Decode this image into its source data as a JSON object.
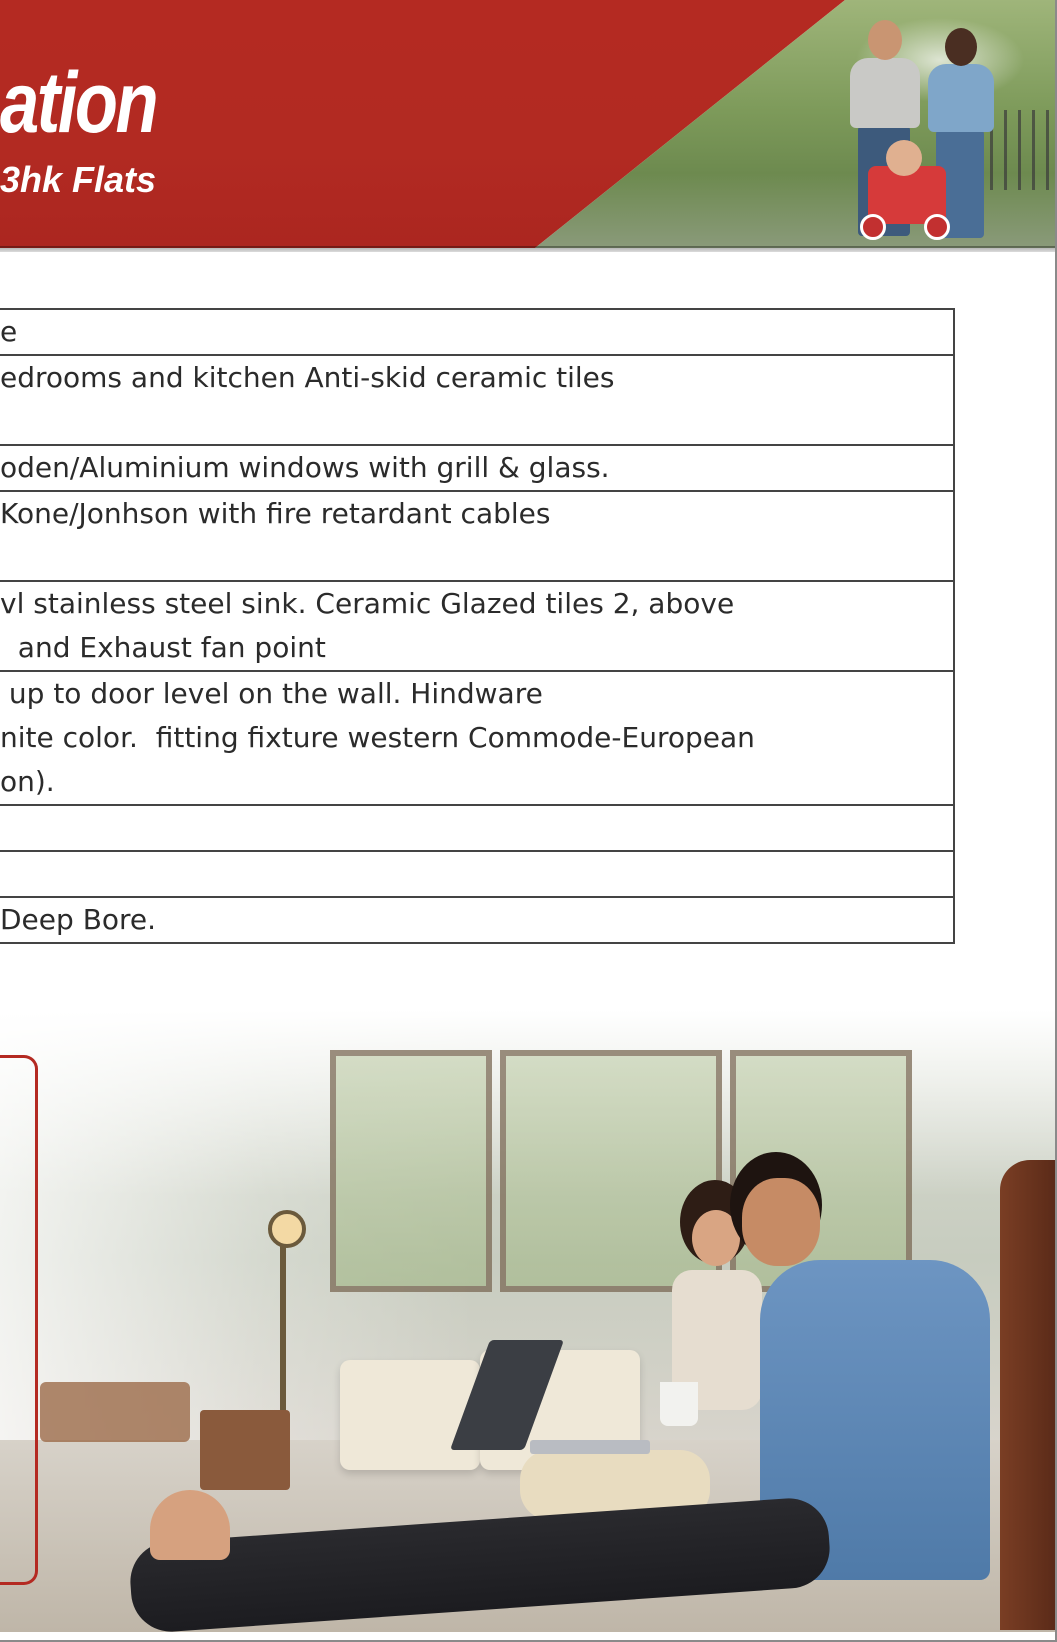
{
  "header": {
    "title": "ation",
    "subtitle": "3hk Flats",
    "brand_color": "#b42a22"
  },
  "spec_rows": [
    {
      "lines": [
        "e"
      ]
    },
    {
      "lines": [
        "edrooms and kitchen Anti-skid ceramic tiles",
        ""
      ]
    },
    {
      "lines": [
        "oden/Aluminium windows with grill & glass."
      ]
    },
    {
      "lines": [
        "Kone/Jonhson with fire retardant cables",
        ""
      ]
    },
    {
      "lines": [
        "vl stainless steel sink. Ceramic Glazed tiles 2, above",
        "  and Exhaust fan point"
      ]
    },
    {
      "lines": [
        " up to door level on the wall. Hindware",
        "nite color.  fitting fixture western Commode-European",
        "on)."
      ]
    },
    {
      "lines": [
        ""
      ]
    },
    {
      "lines": [
        ""
      ]
    },
    {
      "lines": [
        "Deep Bore."
      ]
    }
  ]
}
